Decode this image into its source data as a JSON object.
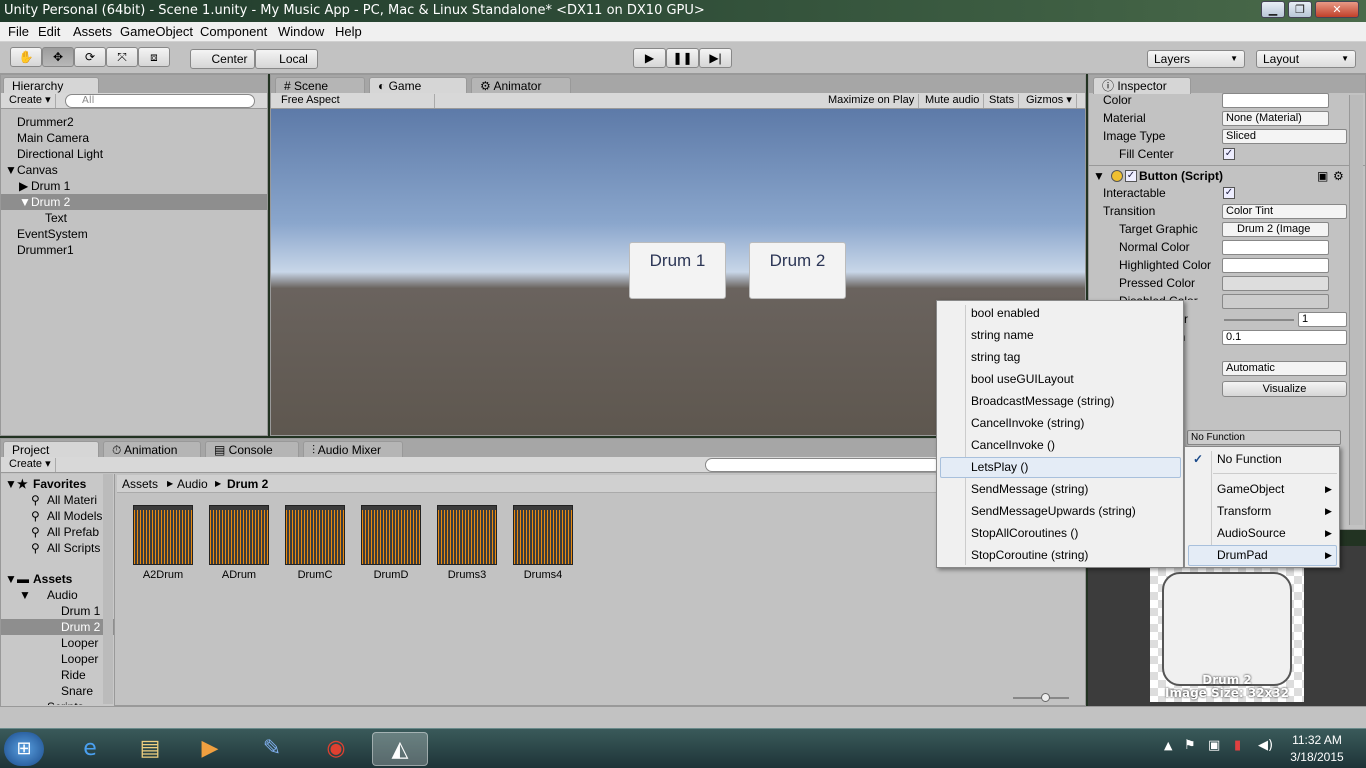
{
  "window": {
    "title": "Unity Personal (64bit) - Scene 1.unity - My Music App - PC, Mac & Linux Standalone* <DX11 on DX10 GPU>"
  },
  "menubar": {
    "items": [
      "File",
      "Edit",
      "Assets",
      "GameObject",
      "Component",
      "Window",
      "Help"
    ]
  },
  "toolbar": {
    "pivot": "Center",
    "space": "Local",
    "layers": "Layers",
    "layout": "Layout"
  },
  "hierarchy": {
    "tab": "Hierarchy",
    "create": "Create",
    "search_placeholder": "All",
    "items": [
      "Drummer2",
      "Main Camera",
      "Directional Light",
      "Canvas",
      "Drum 1",
      "Drum 2",
      "Text",
      "EventSystem",
      "Drummer1"
    ]
  },
  "scene_tabs": {
    "scene": "Scene",
    "game": "Game",
    "animator": "Animator"
  },
  "game_bar": {
    "aspect": "Free Aspect",
    "maximize": "Maximize on Play",
    "mute": "Mute audio",
    "stats": "Stats",
    "gizmos": "Gizmos"
  },
  "game_view": {
    "button1": "Drum 1",
    "button2": "Drum 2"
  },
  "inspector": {
    "tab": "Inspector",
    "color_label": "Color",
    "material_label": "Material",
    "material_value": "None (Material)",
    "image_type_label": "Image Type",
    "image_type_value": "Sliced",
    "fill_center_label": "Fill Center",
    "component_title": "Button (Script)",
    "interactable_label": "Interactable",
    "transition_label": "Transition",
    "transition_value": "Color Tint",
    "target_graphic_label": "Target Graphic",
    "target_graphic_value": "Drum 2 (Image",
    "normal_color_label": "Normal Color",
    "highlighted_color_label": "Highlighted Color",
    "pressed_color_label": "Pressed Color",
    "disabled_color_label": "Disabled Color",
    "multiplier_partial": "lier",
    "multiplier_value": "1",
    "fade_partial": "on",
    "fade_value": "0.1",
    "navigation_value": "Automatic",
    "visualize": "Visualize",
    "onclick_function": "No Function",
    "preview_name": "Drum 2",
    "preview_size": "Image Size: 32x32"
  },
  "project": {
    "tabs": {
      "project": "Project",
      "animation": "Animation",
      "console": "Console",
      "mixer": "Audio Mixer"
    },
    "create": "Create",
    "favorites_label": "Favorites",
    "favorites": [
      "All Materi",
      "All Models",
      "All Prefab",
      "All Scripts"
    ],
    "assets_label": "Assets",
    "tree": [
      "Audio",
      "Drum 1",
      "Drum 2",
      "Looper",
      "Looper",
      "Ride",
      "Snare",
      "Scripts"
    ],
    "breadcrumb": [
      "Assets",
      "Audio",
      "Drum 2"
    ],
    "files": [
      "A2Drum",
      "ADrum",
      "DrumC",
      "DrumD",
      "Drums3",
      "Drums4"
    ]
  },
  "function_menu": {
    "items": [
      "bool enabled",
      "string name",
      "string tag",
      "bool useGUILayout",
      "BroadcastMessage (string)",
      "CancelInvoke (string)",
      "CancelInvoke ()",
      "LetsPlay ()",
      "SendMessage (string)",
      "SendMessageUpwards (string)",
      "StopAllCoroutines ()",
      "StopCoroutine (string)"
    ],
    "highlighted": "LetsPlay ()"
  },
  "object_menu": {
    "items": [
      "No Function",
      "GameObject",
      "Transform",
      "AudioSource",
      "DrumPad"
    ],
    "checked": "No Function",
    "highlighted": "DrumPad"
  },
  "taskbar": {
    "time": "11:32 AM",
    "date": "3/18/2015"
  },
  "colors": {
    "unity_gray": "#c2c2c2",
    "selection": "#8e8e8e",
    "waveform": "#e98a10"
  }
}
